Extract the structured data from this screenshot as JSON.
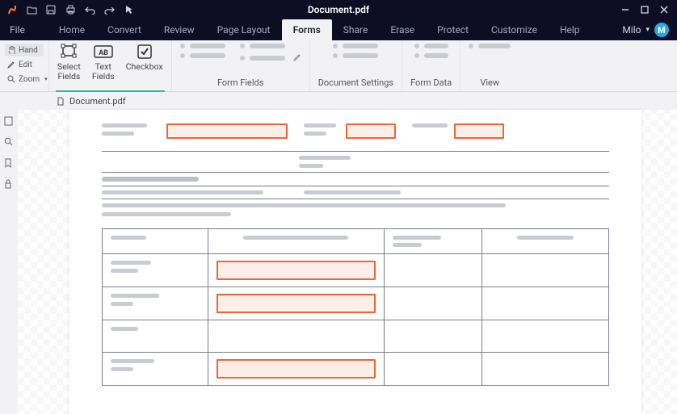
{
  "title": "Document.pdf",
  "menus": {
    "file": "File",
    "tabs": [
      "Home",
      "Convert",
      "Review",
      "Page Layout",
      "Forms",
      "Share",
      "Erase",
      "Protect",
      "Customize",
      "Help"
    ],
    "activeIndex": 4
  },
  "user": {
    "name": "Milo",
    "initial": "M"
  },
  "leftTools": {
    "hand": "Hand",
    "edit": "Edit",
    "zoom": "Zoom"
  },
  "ribbon": {
    "group1": {
      "select": "Select\nFields",
      "text": "Text\nFields",
      "checkbox": "Checkbox"
    },
    "group2Label": "Form Fields",
    "group3Label": "Document Settings",
    "group4Label": "Form Data",
    "group5Label": "View"
  },
  "docTab": {
    "name": "Document.pdf"
  },
  "icons": {
    "app": "app-icon",
    "open": "folder-open-icon",
    "save": "save-icon",
    "print": "print-icon",
    "undo": "undo-icon",
    "redo": "redo-icon",
    "pointer": "pointer-icon",
    "minimize": "minimize-icon",
    "maximize": "maximize-icon",
    "close": "close-icon",
    "hand": "hand-icon",
    "edit": "edit-icon",
    "zoom": "magnifier-icon",
    "selectFields": "crop-icon",
    "textFields": "ab-box-icon",
    "checkbox": "checkbox-icon",
    "railPage": "page-icon",
    "railSearch": "search-icon",
    "railBookmark": "bookmark-icon",
    "railLock": "lock-icon",
    "docFile": "file-icon"
  }
}
